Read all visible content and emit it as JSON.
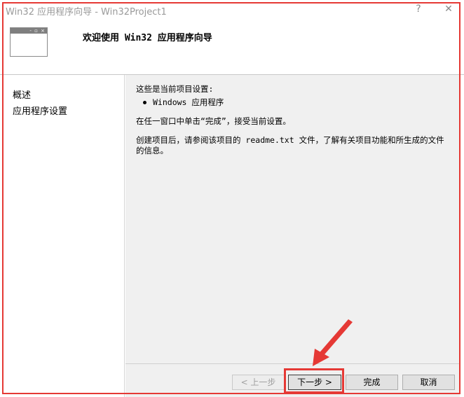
{
  "window": {
    "title": "Win32 应用程序向导 - Win32Project1",
    "help_glyph": "?",
    "close_glyph": "✕"
  },
  "header": {
    "title": "欢迎使用 Win32 应用程序向导",
    "icon": "window-icon"
  },
  "sidebar": {
    "items": [
      {
        "label": "概述"
      },
      {
        "label": "应用程序设置"
      }
    ]
  },
  "content": {
    "line1": "这些是当前项目设置:",
    "bullet": "Windows 应用程序",
    "line3": "在任一窗口中单击“完成”，接受当前设置。",
    "line4": "创建项目后，请参阅该项目的 readme.txt 文件，了解有关项目功能和所生成的文件的信息。"
  },
  "buttons": {
    "prev": "< 上一步",
    "next": "下一步 >",
    "finish": "完成",
    "cancel": "取消"
  },
  "annotation": {
    "color": "#e53935"
  }
}
